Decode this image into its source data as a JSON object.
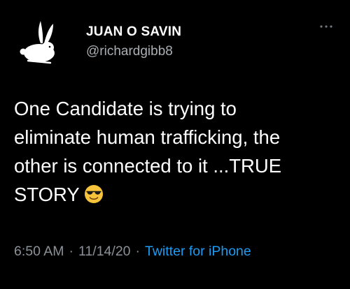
{
  "author": {
    "display_name": "JUAN O SAVIN",
    "handle": "@richardgibb8",
    "avatar_icon": "rabbit-icon"
  },
  "tweet": {
    "lines": [
      "One Candidate is trying to",
      "eliminate human trafficking, the",
      "other is connected to it ...TRUE",
      "STORY"
    ],
    "emoji_icon": "smiling-face-with-sunglasses-emoji"
  },
  "meta": {
    "time": "6:50 AM",
    "date": "11/14/20",
    "separator": "·",
    "source": "Twitter for iPhone"
  },
  "colors": {
    "background": "#000000",
    "text": "#ffffff",
    "secondary_text": "#8b9198",
    "link": "#1d9bf0"
  }
}
